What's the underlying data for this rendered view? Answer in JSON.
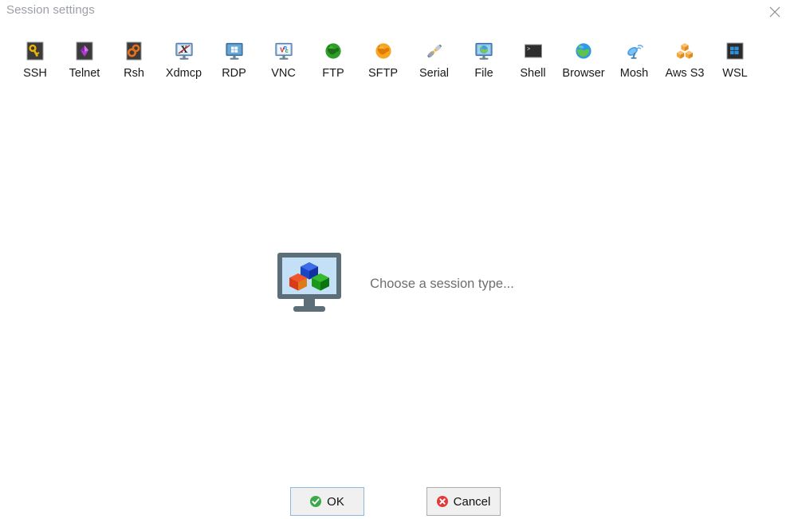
{
  "window": {
    "title": "Session settings",
    "close_icon": "close-icon"
  },
  "session_types": [
    {
      "label": "SSH",
      "icon": "ssh-key-icon"
    },
    {
      "label": "Telnet",
      "icon": "telnet-gem-icon"
    },
    {
      "label": "Rsh",
      "icon": "rsh-gears-icon"
    },
    {
      "label": "Xdmcp",
      "icon": "xdmcp-monitor-x-icon"
    },
    {
      "label": "RDP",
      "icon": "rdp-monitor-windows-icon"
    },
    {
      "label": "VNC",
      "icon": "vnc-monitor-icon"
    },
    {
      "label": "FTP",
      "icon": "ftp-green-globe-icon"
    },
    {
      "label": "SFTP",
      "icon": "sftp-orange-globe-icon"
    },
    {
      "label": "Serial",
      "icon": "serial-connector-icon"
    },
    {
      "label": "File",
      "icon": "file-monitor-globe-icon"
    },
    {
      "label": "Shell",
      "icon": "shell-terminal-icon"
    },
    {
      "label": "Browser",
      "icon": "browser-globe-icon"
    },
    {
      "label": "Mosh",
      "icon": "mosh-satellite-dish-icon"
    },
    {
      "label": "Aws S3",
      "icon": "aws-s3-cubes-icon"
    },
    {
      "label": "WSL",
      "icon": "wsl-windows-icon"
    }
  ],
  "main": {
    "placeholder_text": "Choose a session type...",
    "placeholder_icon": "monitor-cubes-icon"
  },
  "buttons": {
    "ok_label": "OK",
    "ok_icon": "green-check-circle-icon",
    "cancel_label": "Cancel",
    "cancel_icon": "red-x-circle-icon"
  },
  "colors": {
    "background": "#ffffff",
    "title_text": "#9b9fa6",
    "label_text": "#18191c",
    "placeholder_text": "#6e6e70",
    "button_face": "#f0f0f0",
    "focus_border": "#8fb8e0",
    "ok_accent": "#3aa94a",
    "cancel_accent": "#e03a3a"
  }
}
